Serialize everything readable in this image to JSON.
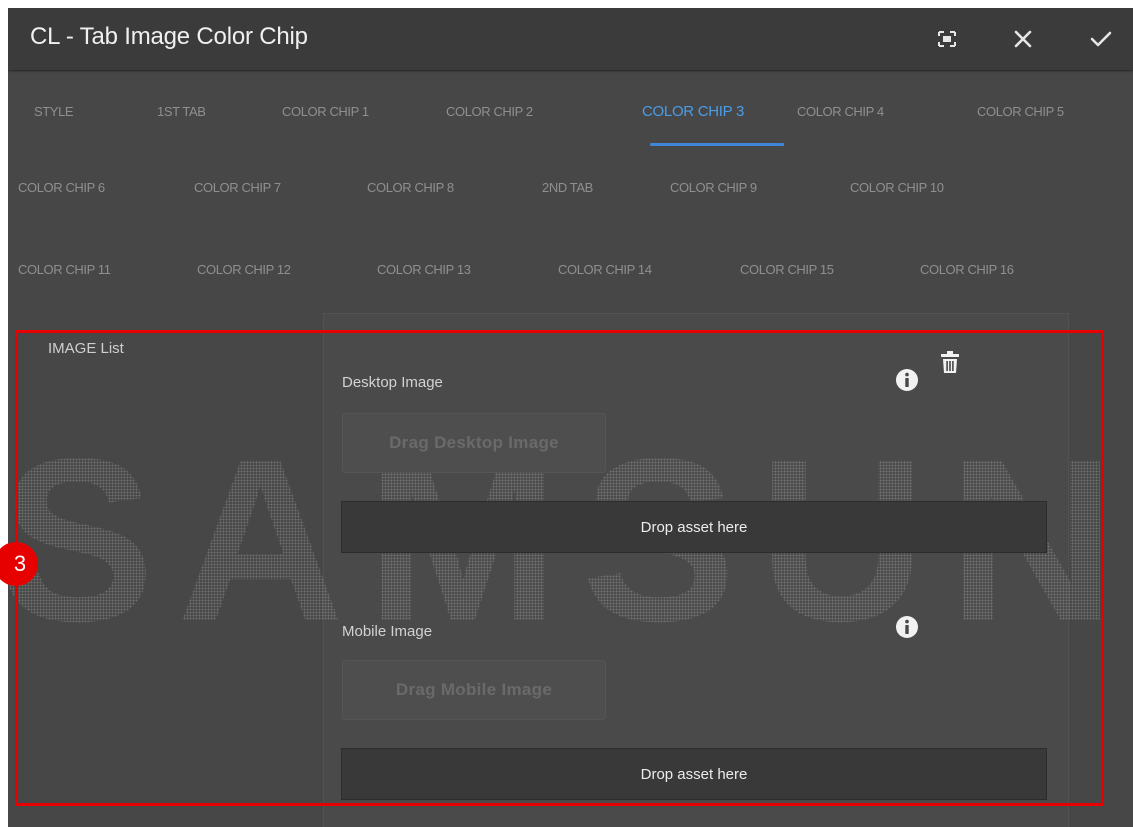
{
  "dialog": {
    "title": "CL - Tab Image Color Chip",
    "actions": {
      "fullscreen_icon": "fullscreen-icon",
      "close_icon": "close-icon",
      "confirm_icon": "check-icon"
    }
  },
  "tabs": {
    "row1": [
      {
        "label": "STYLE"
      },
      {
        "label": "1ST TAB"
      },
      {
        "label": "COLOR CHIP 1"
      },
      {
        "label": "COLOR CHIP 2"
      },
      {
        "label": "COLOR CHIP 3",
        "active": true
      },
      {
        "label": "COLOR CHIP 4"
      },
      {
        "label": "COLOR CHIP 5"
      }
    ],
    "row2": [
      {
        "label": "COLOR CHIP 6"
      },
      {
        "label": "COLOR CHIP 7"
      },
      {
        "label": "COLOR CHIP 8"
      },
      {
        "label": "2ND TAB"
      },
      {
        "label": "COLOR CHIP 9"
      },
      {
        "label": "COLOR CHIP 10"
      }
    ],
    "row3": [
      {
        "label": "COLOR CHIP 11"
      },
      {
        "label": "COLOR CHIP 12"
      },
      {
        "label": "COLOR CHIP 13"
      },
      {
        "label": "COLOR CHIP 14"
      },
      {
        "label": "COLOR CHIP 15"
      },
      {
        "label": "COLOR CHIP 16"
      }
    ]
  },
  "content": {
    "section_label": "IMAGE List",
    "watermark": "SAMSUNG",
    "desktop": {
      "label": "Desktop Image",
      "drag_button": "Drag Desktop Image",
      "dropzone": "Drop asset here"
    },
    "mobile": {
      "label": "Mobile Image",
      "drag_button": "Drag Mobile Image",
      "dropzone": "Drop asset here"
    }
  },
  "annotation": {
    "step_number": "3",
    "highlight_color": "#e60000"
  },
  "colors": {
    "background": "#474747",
    "titlebar": "#3b3b3b",
    "active_tab": "#4a9de7",
    "inactive_tab": "#8f8f8f"
  }
}
